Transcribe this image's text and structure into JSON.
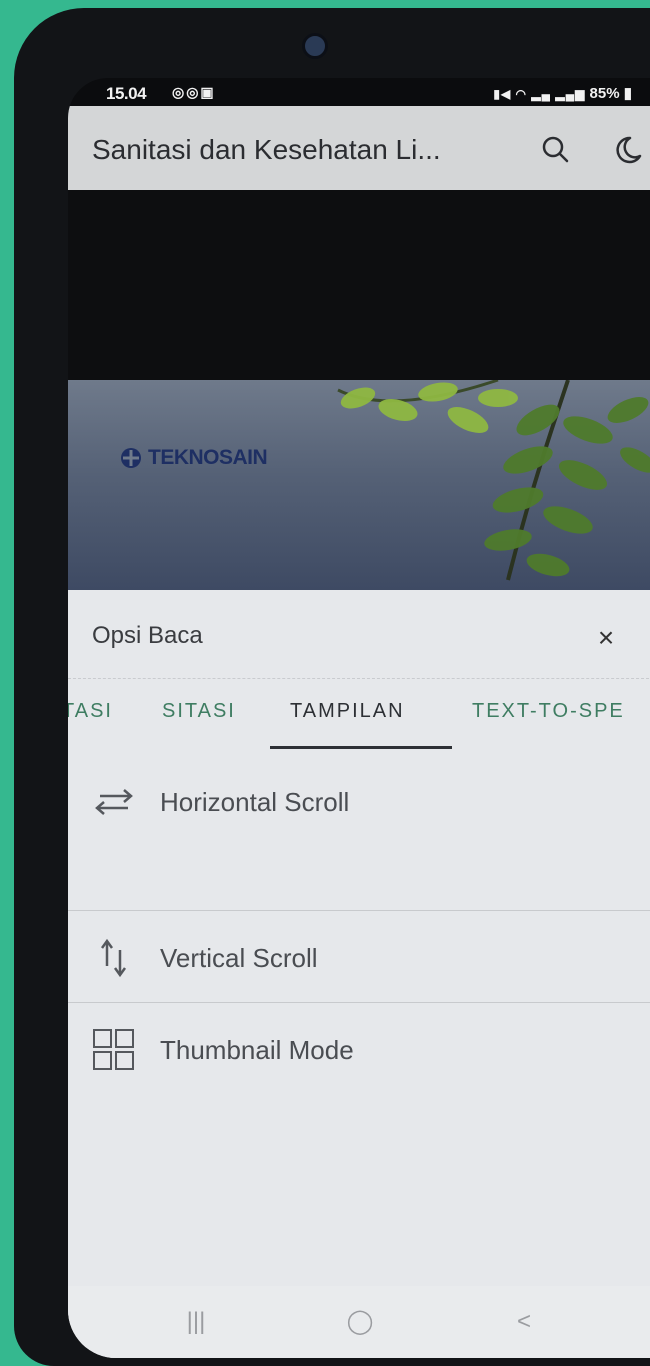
{
  "status_bar": {
    "time": "15.04",
    "left_icons": "◎◎▣",
    "right_text": "85%"
  },
  "app_bar": {
    "title": "Sanitasi dan Kesehatan Li..."
  },
  "cover": {
    "brand": "TEKNOSAIN"
  },
  "sheet": {
    "title": "Opsi Baca",
    "close": "×",
    "tabs": [
      {
        "label": "TASI",
        "active": false
      },
      {
        "label": "SITASI",
        "active": false
      },
      {
        "label": "TAMPILAN",
        "active": true
      },
      {
        "label": "TEXT-TO-SPE",
        "active": false
      }
    ],
    "options": [
      {
        "label": "Horizontal Scroll",
        "icon": "horizontal-arrows-icon"
      },
      {
        "label": "Vertical Scroll",
        "icon": "vertical-arrows-icon"
      },
      {
        "label": "Thumbnail Mode",
        "icon": "grid-icon"
      }
    ]
  },
  "nav_bar": {
    "recent": "|||",
    "home": "◯",
    "back": "<"
  },
  "colors": {
    "accent_green": "#3f7d62",
    "sheet_bg": "#e6e8eb",
    "appbar_bg": "#d4d6d7"
  }
}
